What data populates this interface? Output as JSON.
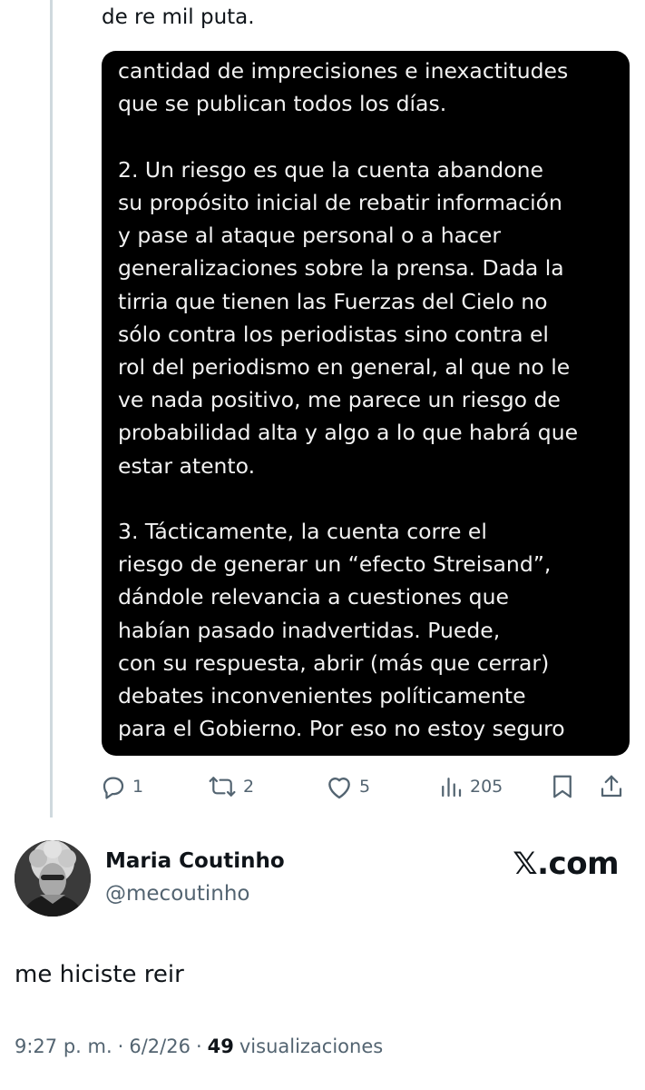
{
  "reply": {
    "text": "de re mil puta.",
    "image_text": "los periodistas no se dan cuenta de la\ncantidad de imprecisiones e inexactitudes\nque se publican todos los días.\n\n2. Un riesgo es que la cuenta abandone\nsu propósito inicial de rebatir información\ny pase al ataque personal o a hacer\ngeneralizaciones sobre la prensa. Dada la\ntirria que tienen las Fuerzas del Cielo no\nsólo contra los periodistas sino contra el\nrol del periodismo en general, al que no le\nve nada positivo, me parece un riesgo de\nprobabilidad alta y algo a lo que habrá que\nestar atento.\n\n3. Tácticamente, la cuenta corre el\nriesgo de generar un “efecto Streisand”,\ndándole relevancia a cuestiones que\nhabían pasado inadvertidas. Puede,\ncon su respuesta, abrir (más que cerrar)\ndebates inconvenientes políticamente\npara el Gobierno. Por eso no estoy seguro",
    "actions": {
      "replies": "1",
      "reposts": "2",
      "likes": "5",
      "views": "205"
    }
  },
  "author": {
    "name": "Maria Coutinho",
    "handle": "@mecoutinho",
    "brand": "𝕏.com"
  },
  "tweet": {
    "text": "me hiciste reir",
    "time": "9:27 p. m.",
    "sep1": "·",
    "date": "6/2/26",
    "sep2": "·",
    "views_count": "49",
    "views_label": "visualizaciones"
  },
  "colors": {
    "secondary_text": "#536471",
    "thread_line": "#cfd9de",
    "media_bg": "#000000"
  }
}
